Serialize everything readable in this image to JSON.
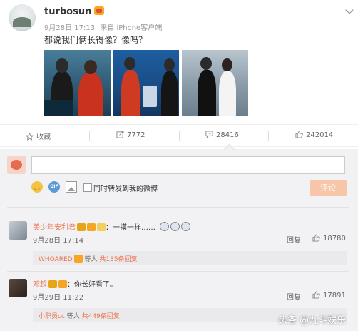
{
  "post": {
    "username": "turbosun",
    "date": "9月28日 17:13",
    "source": "来自 iPhone客户端",
    "text": "都说我们俩长得像？像吗？"
  },
  "actions": {
    "favorite_label": "收藏",
    "repost_count": "7772",
    "comment_count": "28416",
    "like_count": "242014"
  },
  "composer": {
    "forward_label": "同时转发到我的微博",
    "submit_label": "评论"
  },
  "comments": [
    {
      "name": "美少年安利君",
      "text": "：一摸一样……",
      "time": "9月28日 17:14",
      "reply_label": "回复",
      "likes": "18780",
      "sub_name": "WHOARED",
      "sub_mid": "等人",
      "sub_count": "共135条回复"
    },
    {
      "name": "邓超",
      "text": "：你长好看了。",
      "time": "9月29日 11:22",
      "reply_label": "回复",
      "likes": "17891",
      "sub_name": "小职员cc",
      "sub_mid": "等人",
      "sub_count": "共449条回复"
    }
  ],
  "watermark": "头条 @九斗娱乐",
  "icons": [
    "star-icon",
    "repost-icon",
    "comment-icon",
    "like-icon",
    "emoji-icon",
    "gif-icon",
    "image-icon",
    "chevron-down-icon"
  ],
  "colors": {
    "accent": "#eb7350",
    "submit_bg": "#f7c5a8",
    "panel_bg": "#f2f2f5"
  }
}
